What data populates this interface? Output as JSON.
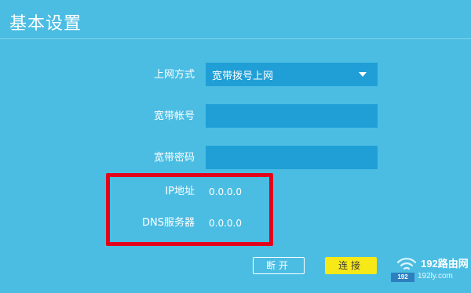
{
  "page": {
    "title": "基本设置"
  },
  "form": {
    "connection_type": {
      "label": "上网方式",
      "value": "宽带拨号上网"
    },
    "account": {
      "label": "宽带帐号",
      "value": ""
    },
    "password": {
      "label": "宽带密码",
      "value": ""
    },
    "ip_address": {
      "label": "IP地址",
      "value": "0.0.0.0"
    },
    "dns_server": {
      "label": "DNS服务器",
      "value": "0.0.0.0"
    }
  },
  "buttons": {
    "disconnect": "断开",
    "connect": "连接"
  },
  "watermark": {
    "brand": "192路由网",
    "strip": "192",
    "domain": "192ly.com"
  },
  "colors": {
    "background": "#4bbde3",
    "field": "#1f9fd6",
    "highlight": "#e3001b",
    "connect_button": "#f7e917"
  },
  "icons": {
    "select_caret": "caret-down-icon",
    "watermark": "wifi-icon"
  }
}
